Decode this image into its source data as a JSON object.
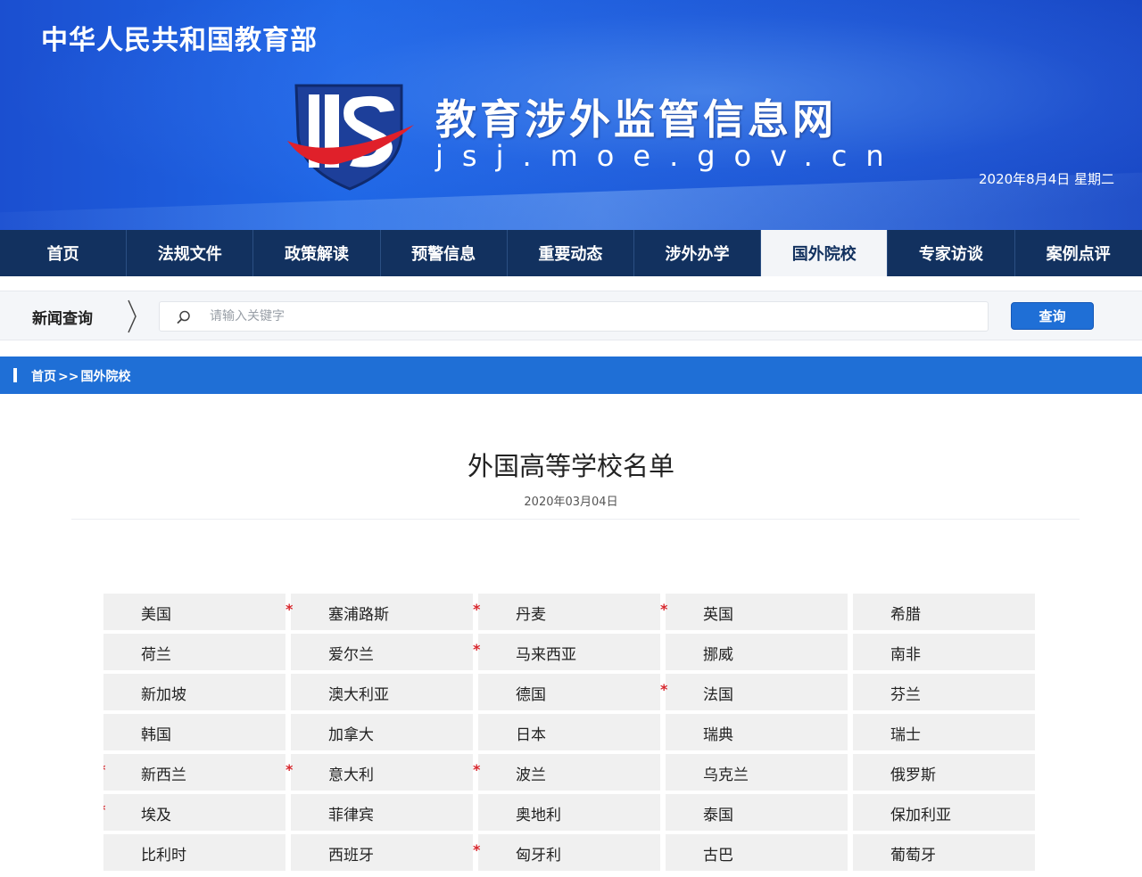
{
  "header": {
    "ministry": "中华人民共和国教育部",
    "site_title": "教育涉外监管信息网",
    "site_domain": "jsj.moe.gov.cn",
    "current_date": "2020年8月4日  星期二"
  },
  "nav": {
    "items": [
      {
        "label": "首页",
        "active": false
      },
      {
        "label": "法规文件",
        "active": false
      },
      {
        "label": "政策解读",
        "active": false
      },
      {
        "label": "预警信息",
        "active": false
      },
      {
        "label": "重要动态",
        "active": false
      },
      {
        "label": "涉外办学",
        "active": false
      },
      {
        "label": "国外院校",
        "active": true
      },
      {
        "label": "专家访谈",
        "active": false
      },
      {
        "label": "案例点评",
        "active": false
      }
    ]
  },
  "search": {
    "label": "新闻查询",
    "placeholder": "请输入关键字",
    "value": "",
    "button_label": "查询"
  },
  "breadcrumb": {
    "home": "首页",
    "separator": ">>",
    "current": "国外院校"
  },
  "article": {
    "title": "外国高等学校名单",
    "date": "2020年03月04日"
  },
  "colors": {
    "banner_blue": "#1f67e6",
    "nav_navy": "#12315f",
    "accent_blue": "#1f6fd6",
    "star_red": "#d7262c"
  },
  "countries": {
    "rows": [
      [
        {
          "name": "美国",
          "star": false
        },
        {
          "name": "塞浦路斯",
          "star": true
        },
        {
          "name": "丹麦",
          "star": true
        },
        {
          "name": "英国",
          "star": true
        },
        {
          "name": "希腊",
          "star": false
        }
      ],
      [
        {
          "name": "荷兰",
          "star": false
        },
        {
          "name": "爱尔兰",
          "star": false
        },
        {
          "name": "马来西亚",
          "star": true
        },
        {
          "name": "挪威",
          "star": false
        },
        {
          "name": "南非",
          "star": false
        }
      ],
      [
        {
          "name": "新加坡",
          "star": false
        },
        {
          "name": "澳大利亚",
          "star": false
        },
        {
          "name": "德国",
          "star": false
        },
        {
          "name": "法国",
          "star": true
        },
        {
          "name": "芬兰",
          "star": false
        }
      ],
      [
        {
          "name": "韩国",
          "star": false
        },
        {
          "name": "加拿大",
          "star": false
        },
        {
          "name": "日本",
          "star": false
        },
        {
          "name": "瑞典",
          "star": false
        },
        {
          "name": "瑞士",
          "star": false
        }
      ],
      [
        {
          "name": "新西兰",
          "star": true
        },
        {
          "name": "意大利",
          "star": true
        },
        {
          "name": "波兰",
          "star": true
        },
        {
          "name": "乌克兰",
          "star": false
        },
        {
          "name": "俄罗斯",
          "star": false
        }
      ],
      [
        {
          "name": "埃及",
          "star": true
        },
        {
          "name": "菲律宾",
          "star": false
        },
        {
          "name": "奥地利",
          "star": false
        },
        {
          "name": "泰国",
          "star": false
        },
        {
          "name": "保加利亚",
          "star": false
        }
      ],
      [
        {
          "name": "比利时",
          "star": false
        },
        {
          "name": "西班牙",
          "star": false
        },
        {
          "name": "匈牙利",
          "star": true
        },
        {
          "name": "古巴",
          "star": false
        },
        {
          "name": "葡萄牙",
          "star": false
        }
      ]
    ],
    "star_glyph": "*"
  }
}
